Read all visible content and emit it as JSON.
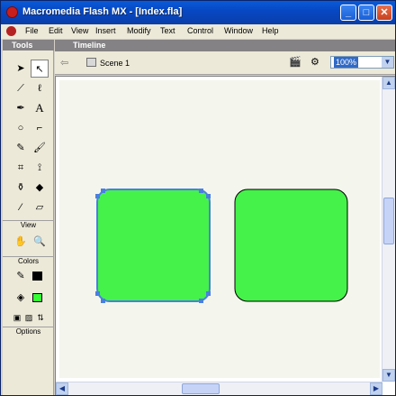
{
  "window": {
    "title": "Macromedia Flash MX - [Index.fla]",
    "buttons": {
      "minimize": "_",
      "maximize": "□",
      "close": "✕"
    }
  },
  "menubar": {
    "items": [
      "File",
      "Edit",
      "View",
      "Insert",
      "Modify",
      "Text",
      "Control",
      "Window",
      "Help"
    ]
  },
  "tools_panel": {
    "title": "Tools",
    "view_label": "View",
    "colors_label": "Colors",
    "options_label": "Options"
  },
  "timeline": {
    "label": "Timeline"
  },
  "edit_bar": {
    "scene_label": "Scene 1",
    "zoom_value": "100%"
  },
  "colors": {
    "stroke": "#000000",
    "fill": "#33ff33",
    "selection": "#4a7fe0",
    "shape_fill": "#44f24a"
  },
  "icons": {
    "back": "back-arrow-icon",
    "scene": "scene-icon",
    "edit_symbols": "edit-symbols-icon",
    "edit_scene": "edit-scene-icon"
  }
}
